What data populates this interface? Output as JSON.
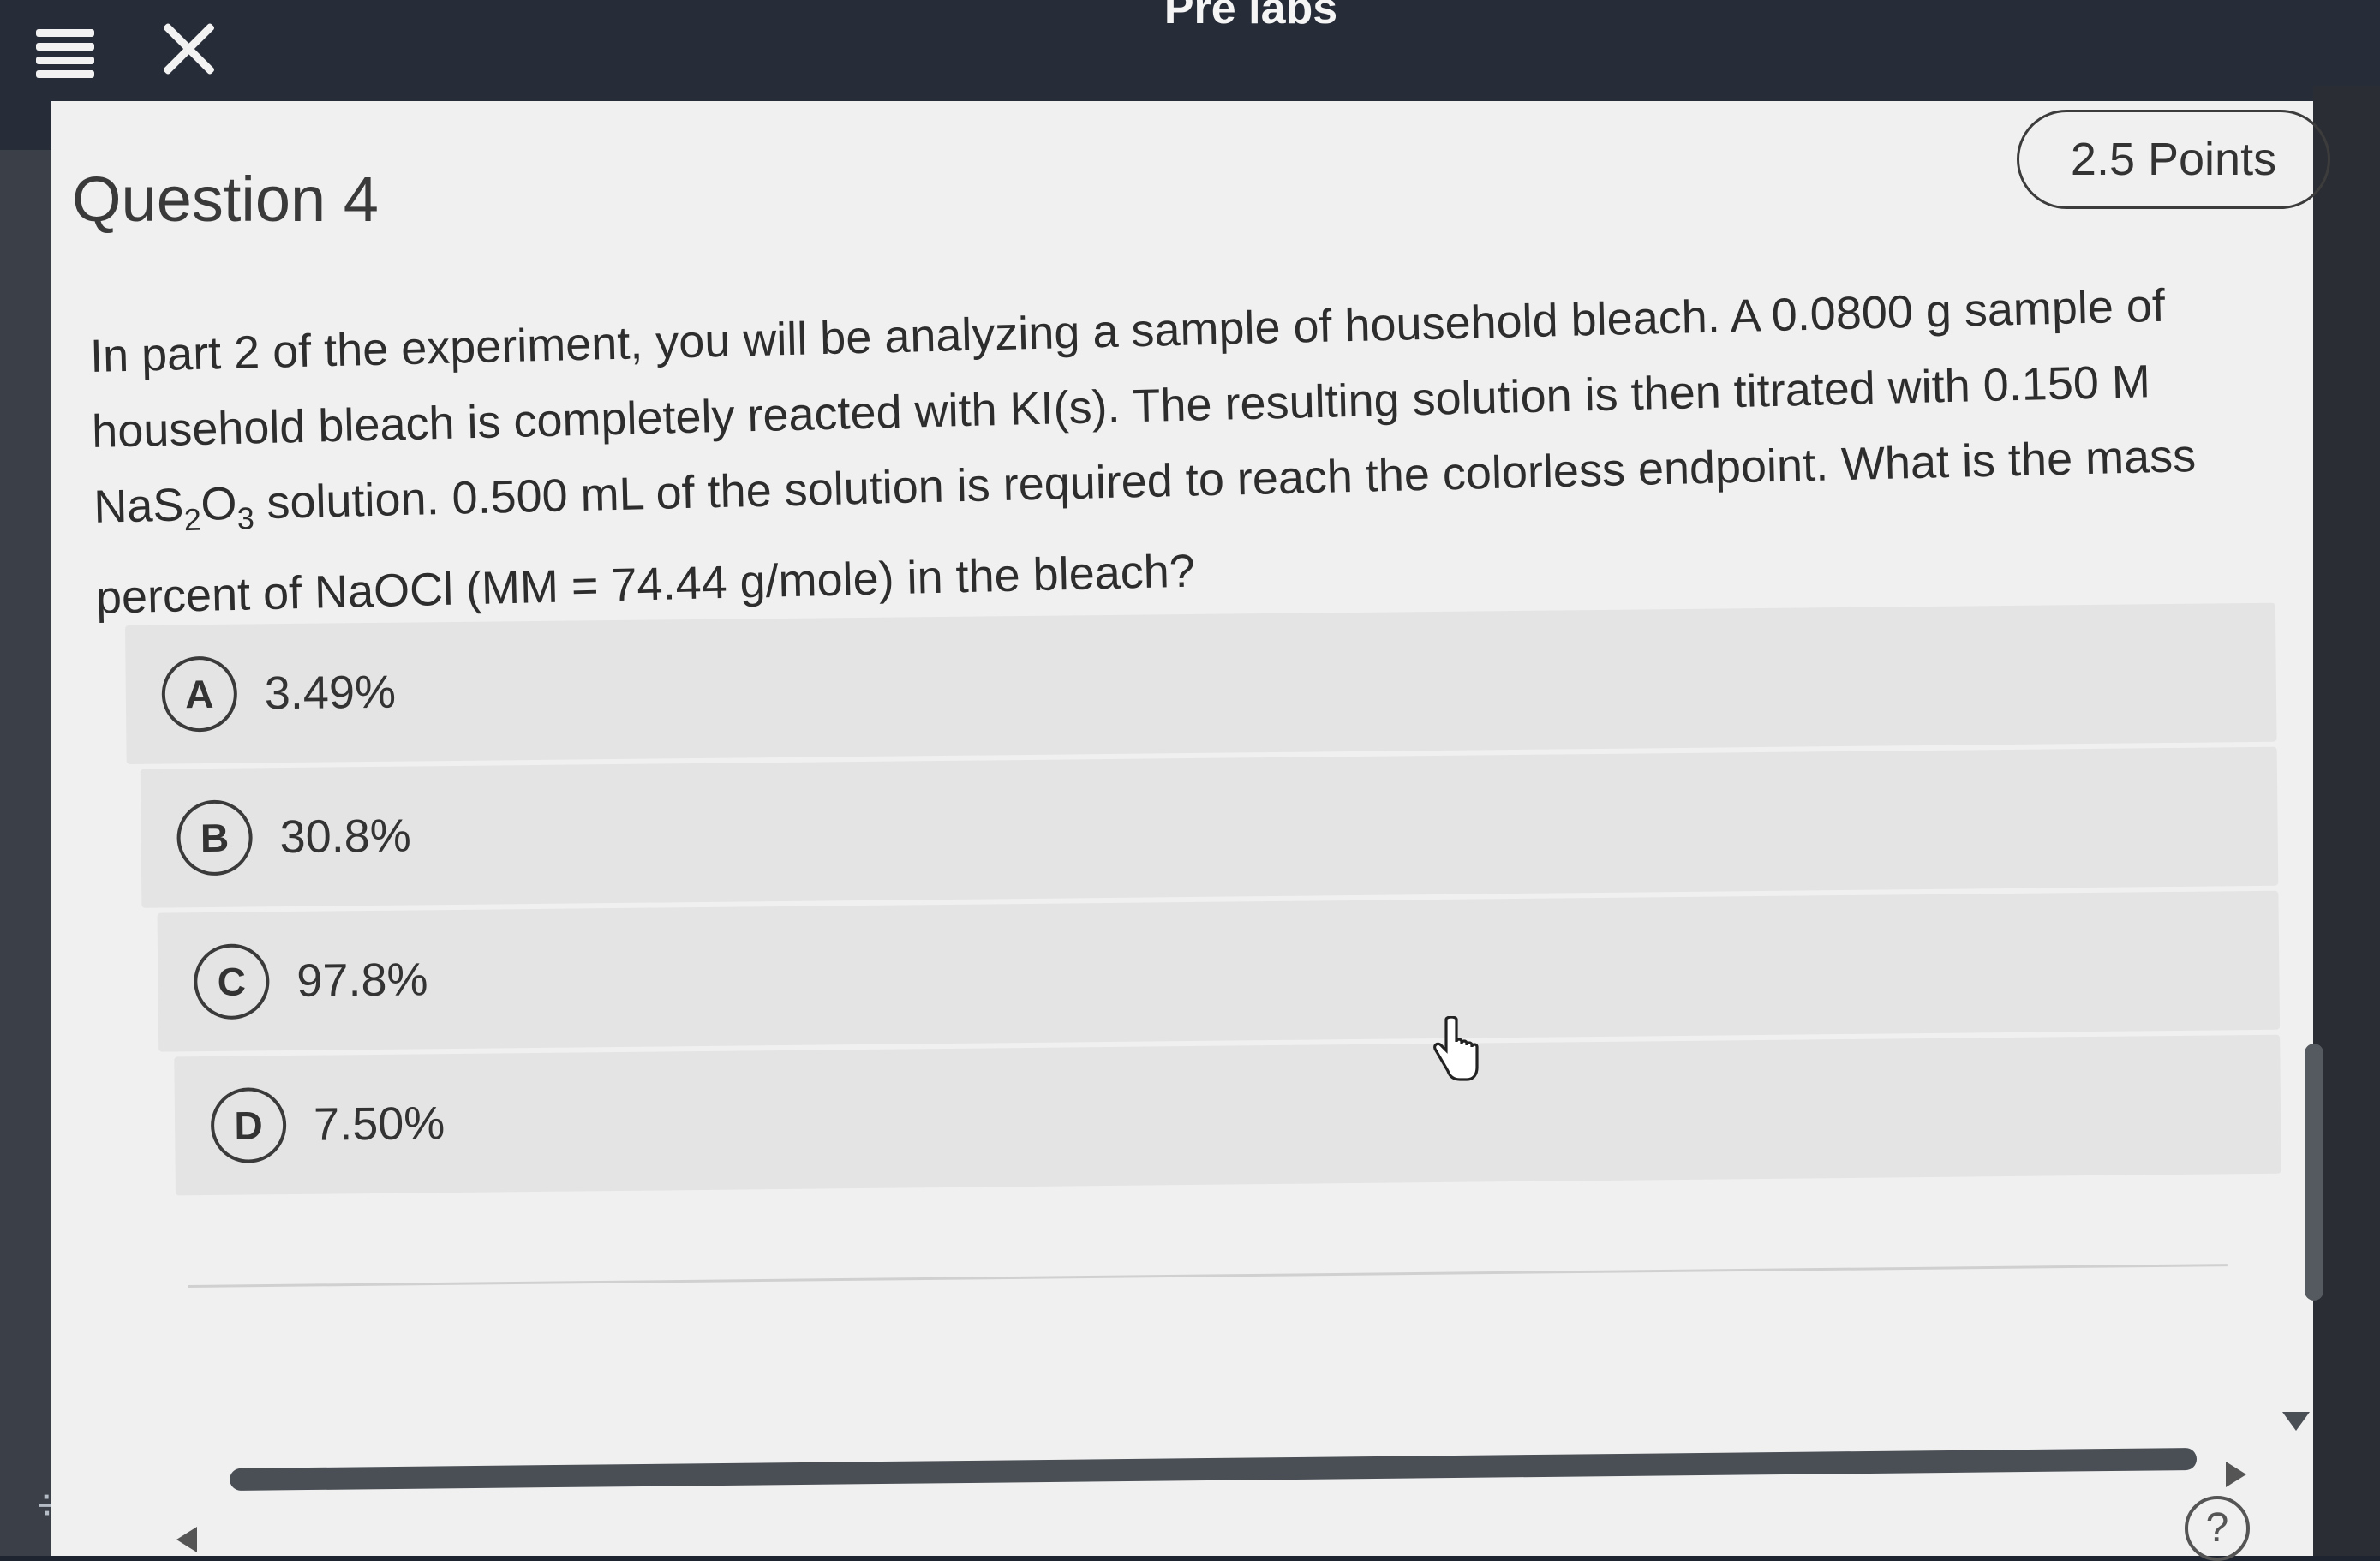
{
  "header": {
    "app_title": "Pre labs",
    "menu_icon": "hamburger-menu-icon",
    "close_icon": "close-x-icon"
  },
  "question": {
    "title": "Question 4",
    "points": "2.5 Points",
    "text_part1": "In part 2 of the experiment, you will be analyzing a sample of household bleach. A 0.0800 g sample of household bleach is completely reacted with KI(s). The resulting solution is then titrated with 0.150 M NaS",
    "sub1": "2",
    "text_part2": "O",
    "sub2": "3",
    "text_part3": " solution. 0.500 mL of the solution is required to reach the colorless endpoint. What is the mass percent of NaOCl (MM = 74.44 g/mole) in the bleach?"
  },
  "choices": [
    {
      "letter": "A",
      "value": "3.49%"
    },
    {
      "letter": "B",
      "value": "30.8%"
    },
    {
      "letter": "C",
      "value": "97.8%"
    },
    {
      "letter": "D",
      "value": "7.50%"
    }
  ],
  "help_label": "?",
  "colors": {
    "topbar": "#262c38",
    "panel": "#f0f0f0",
    "choice_bg": "#e4e4e4"
  }
}
